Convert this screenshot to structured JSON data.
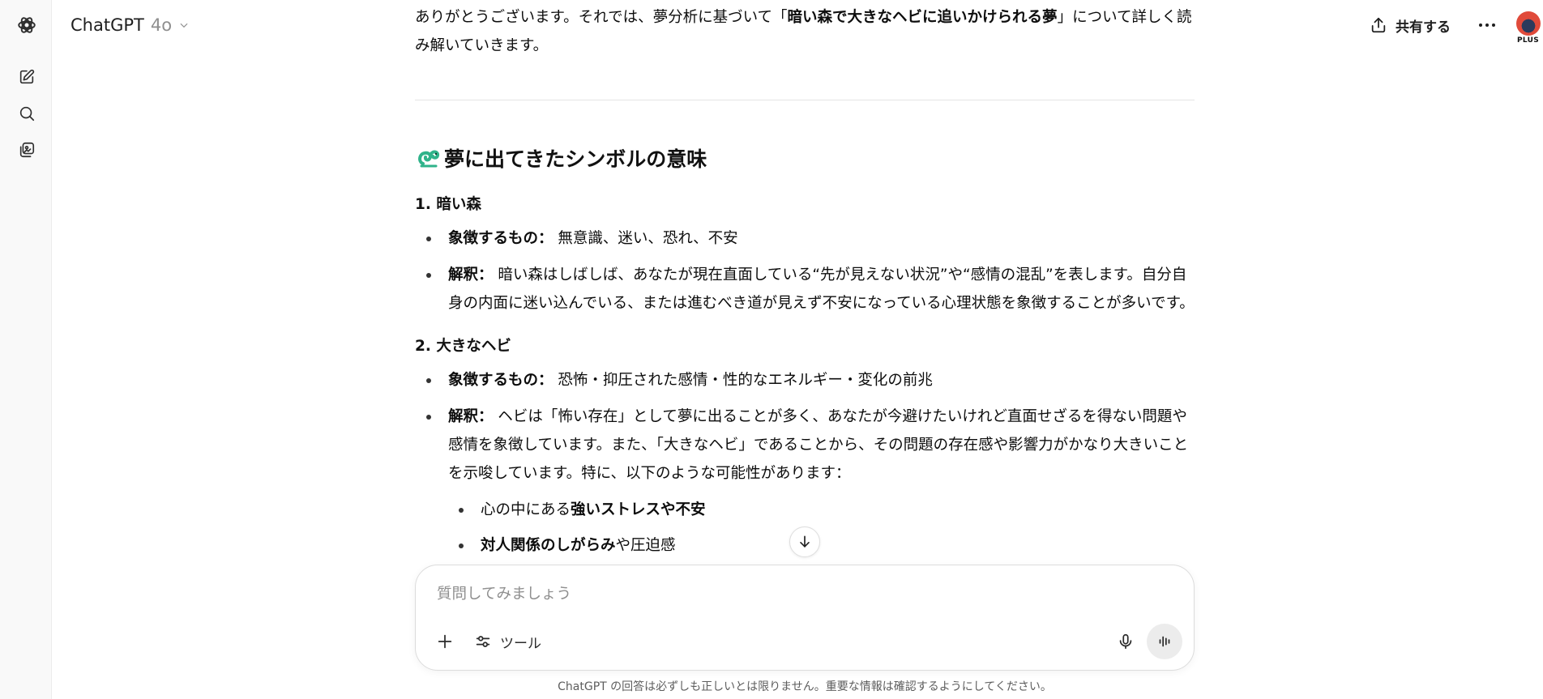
{
  "header": {
    "model_name": "ChatGPT",
    "model_version": "4o",
    "share_label": "共有する",
    "plan_badge": "PLUS"
  },
  "sidebar": {
    "icons": [
      "openai-logo-icon",
      "new-chat-icon",
      "search-icon",
      "library-icon"
    ]
  },
  "conversation": {
    "intro": {
      "before": "ありがとうございます。それでは、夢分析に基づいて「",
      "bold": "暗い森で大きなヘビに追いかけられる夢",
      "after": "」について詳しく読み解いていきます。"
    },
    "section_title": "夢に出てきたシンボルの意味",
    "items": [
      {
        "heading": "1. 暗い森",
        "symbol_label": "象徴するもの：",
        "symbol_text": " 無意識、迷い、恐れ、不安",
        "interp_label": "解釈：",
        "interp_text": " 暗い森はしばしば、あなたが現在直面している“先が見えない状況”や“感情の混乱”を表します。自分自身の内面に迷い込んでいる、または進むべき道が見えず不安になっている心理状態を象徴することが多いです。"
      },
      {
        "heading": "2. 大きなヘビ",
        "symbol_label": "象徴するもの：",
        "symbol_text": " 恐怖・抑圧された感情・性的なエネルギー・変化の前兆",
        "interp_label": "解釈：",
        "interp_text": " ヘビは「怖い存在」として夢に出ることが多く、あなたが今避けたいけれど直面せざるを得ない問題や感情を象徴しています。また、「大きなヘビ」であることから、その問題の存在感や影響力がかなり大きいことを示唆しています。特に、以下のような可能性があります："
      }
    ],
    "sub_bullets": [
      {
        "prefix": "心の中にある",
        "bold": "強いストレスや不安",
        "suffix": ""
      },
      {
        "prefix": "",
        "bold": "対人関係のしがらみ",
        "suffix": "や圧迫感"
      }
    ]
  },
  "composer": {
    "placeholder": "質問してみましょう",
    "tools_label": "ツール"
  },
  "footer": {
    "disclaimer": "ChatGPT の回答は必ずしも正しいとは限りません。重要な情報は確認するようにしてください。"
  },
  "colors": {
    "accent_green": "#10a37f",
    "text": "#0d0d0d",
    "muted": "#8e8e8e"
  }
}
